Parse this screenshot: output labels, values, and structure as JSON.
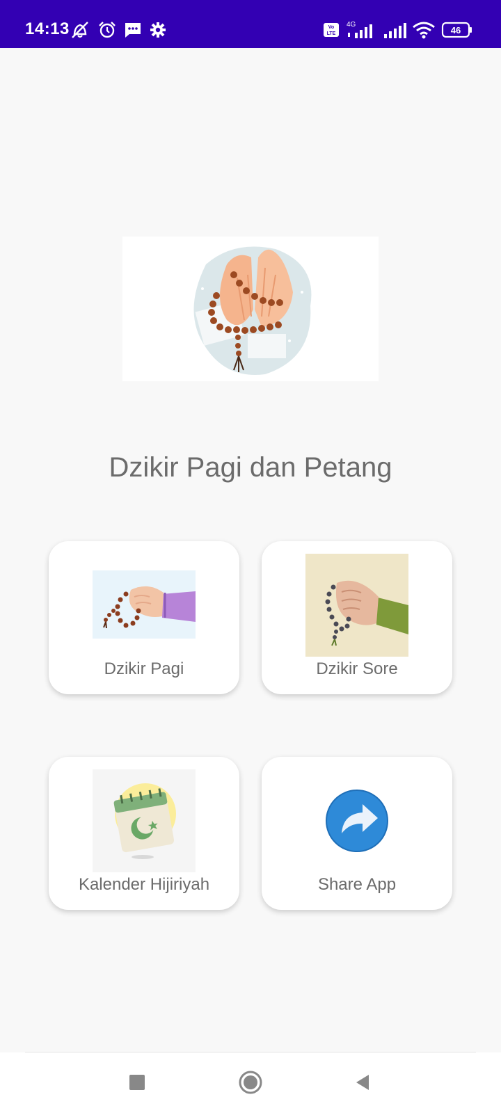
{
  "status_bar": {
    "time": "14:13",
    "battery": "46",
    "network": "4G",
    "volte": "Vo LTE",
    "icons": [
      "mute-icon",
      "alarm-icon",
      "message-icon",
      "settings-icon",
      "volte-icon",
      "signal-icon",
      "signal-icon",
      "wifi-icon",
      "battery-icon"
    ]
  },
  "app": {
    "title": "Dzikir Pagi dan Petang",
    "hero_image": "praying-hands-with-prayer-beads"
  },
  "menu": [
    {
      "label": "Dzikir Pagi",
      "image": "hand-holding-prayer-beads"
    },
    {
      "label": "Dzikir Sore",
      "image": "hand-holding-prayer-beads"
    },
    {
      "label": "Kalender Hijiriyah",
      "image": "islamic-calendar"
    },
    {
      "label": "Share App",
      "image": "share-arrow-icon"
    }
  ],
  "navigation": {
    "buttons": [
      "recents-button",
      "home-button",
      "back-button"
    ]
  },
  "colors": {
    "status_bar": "#3300b3",
    "background": "#f8f8f8",
    "card": "#ffffff",
    "text": "#6b6b6b",
    "share_blue": "#2e8ad8"
  }
}
